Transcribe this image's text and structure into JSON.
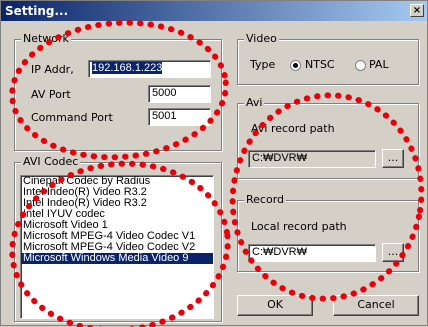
{
  "window": {
    "title": "Setting...",
    "close_label": "×"
  },
  "network": {
    "group_label": "Network",
    "ip_label": "IP Addr,",
    "ip_value": "192.168.1.223",
    "av_port_label": "AV Port",
    "av_port_value": "5000",
    "command_port_label": "Command Port",
    "command_port_value": "5001"
  },
  "video": {
    "group_label": "Video",
    "type_label": "Type",
    "options": [
      "NTSC",
      "PAL"
    ],
    "selected": "NTSC"
  },
  "avi": {
    "group_label": "Avi",
    "path_label": "Avi record path",
    "path_value": "C:₩DVR₩",
    "browse_label": "..."
  },
  "record": {
    "group_label": "Record",
    "path_label": "Local record path",
    "path_value": "C:₩DVR₩",
    "browse_label": "..."
  },
  "avi_codec": {
    "group_label": "AVI Codec",
    "items": [
      "Cinepak Codec by Radius",
      "Intel Indeo(R) Video R3.2",
      "Intel Indeo(R) Video R3.2",
      "Intel IYUV codec",
      "Microsoft Video 1",
      "Microsoft MPEG-4 Video Codec V1",
      "Microsoft MPEG-4 Video Codec V2",
      "Microsoft Windows Media Video 9"
    ],
    "selected_index": 7
  },
  "buttons": {
    "ok": "OK",
    "cancel": "Cancel"
  },
  "colors": {
    "annotation": "#e8000b",
    "title_bar": "#0a246a",
    "selection": "#0a246a"
  }
}
